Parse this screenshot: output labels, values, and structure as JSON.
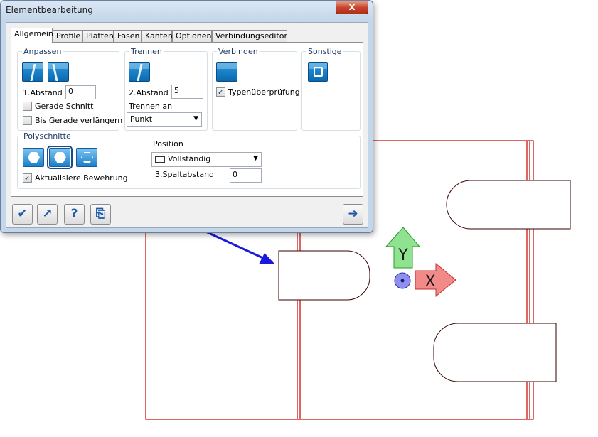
{
  "window": {
    "title": "Elementbearbeitung",
    "close_label": "x"
  },
  "tabs": [
    {
      "label": "Allgemein"
    },
    {
      "label": "Profile"
    },
    {
      "label": "Platten"
    },
    {
      "label": "Fasen"
    },
    {
      "label": "Kanten"
    },
    {
      "label": "Optionen"
    },
    {
      "label": "Verbindungseditor"
    }
  ],
  "anpassen": {
    "title": "Anpassen",
    "abstand_label": "1.Abstand",
    "abstand_value": "0",
    "gerade_schnitt_label": "Gerade Schnitt",
    "gerade_schnitt_checked": false,
    "bis_gerade_label": "Bis Gerade verlängern",
    "bis_gerade_checked": false
  },
  "trennen": {
    "title": "Trennen",
    "abstand_label": "2.Abstand",
    "abstand_value": "5",
    "trennen_an_label": "Trennen an",
    "trennen_an_value": "Punkt"
  },
  "verbinden": {
    "title": "Verbinden",
    "typ_label": "Typenüberprüfung",
    "typ_checked": true,
    "check_glyph": "✓"
  },
  "sonstige": {
    "title": "Sonstige"
  },
  "polyschnitte": {
    "title": "Polyschnitte",
    "aktualisiere_label": "Aktualisiere Bewehrung",
    "aktualisiere_checked": true,
    "position_label": "Position",
    "position_value": "Vollständig",
    "spaltabstand_label": "3.Spaltabstand",
    "spaltabstand_value": "0"
  },
  "buttons": {
    "ok_glyph": "✔",
    "apply_glyph": "↗",
    "help_glyph": "?",
    "copy_glyph": "⎘",
    "next_glyph": "➜"
  },
  "drawing": {
    "axis_y_label": "Y",
    "axis_x_label": "X",
    "line_color": "#cc0000",
    "arrow_color": "#1a1adb"
  },
  "chevron": "▼"
}
